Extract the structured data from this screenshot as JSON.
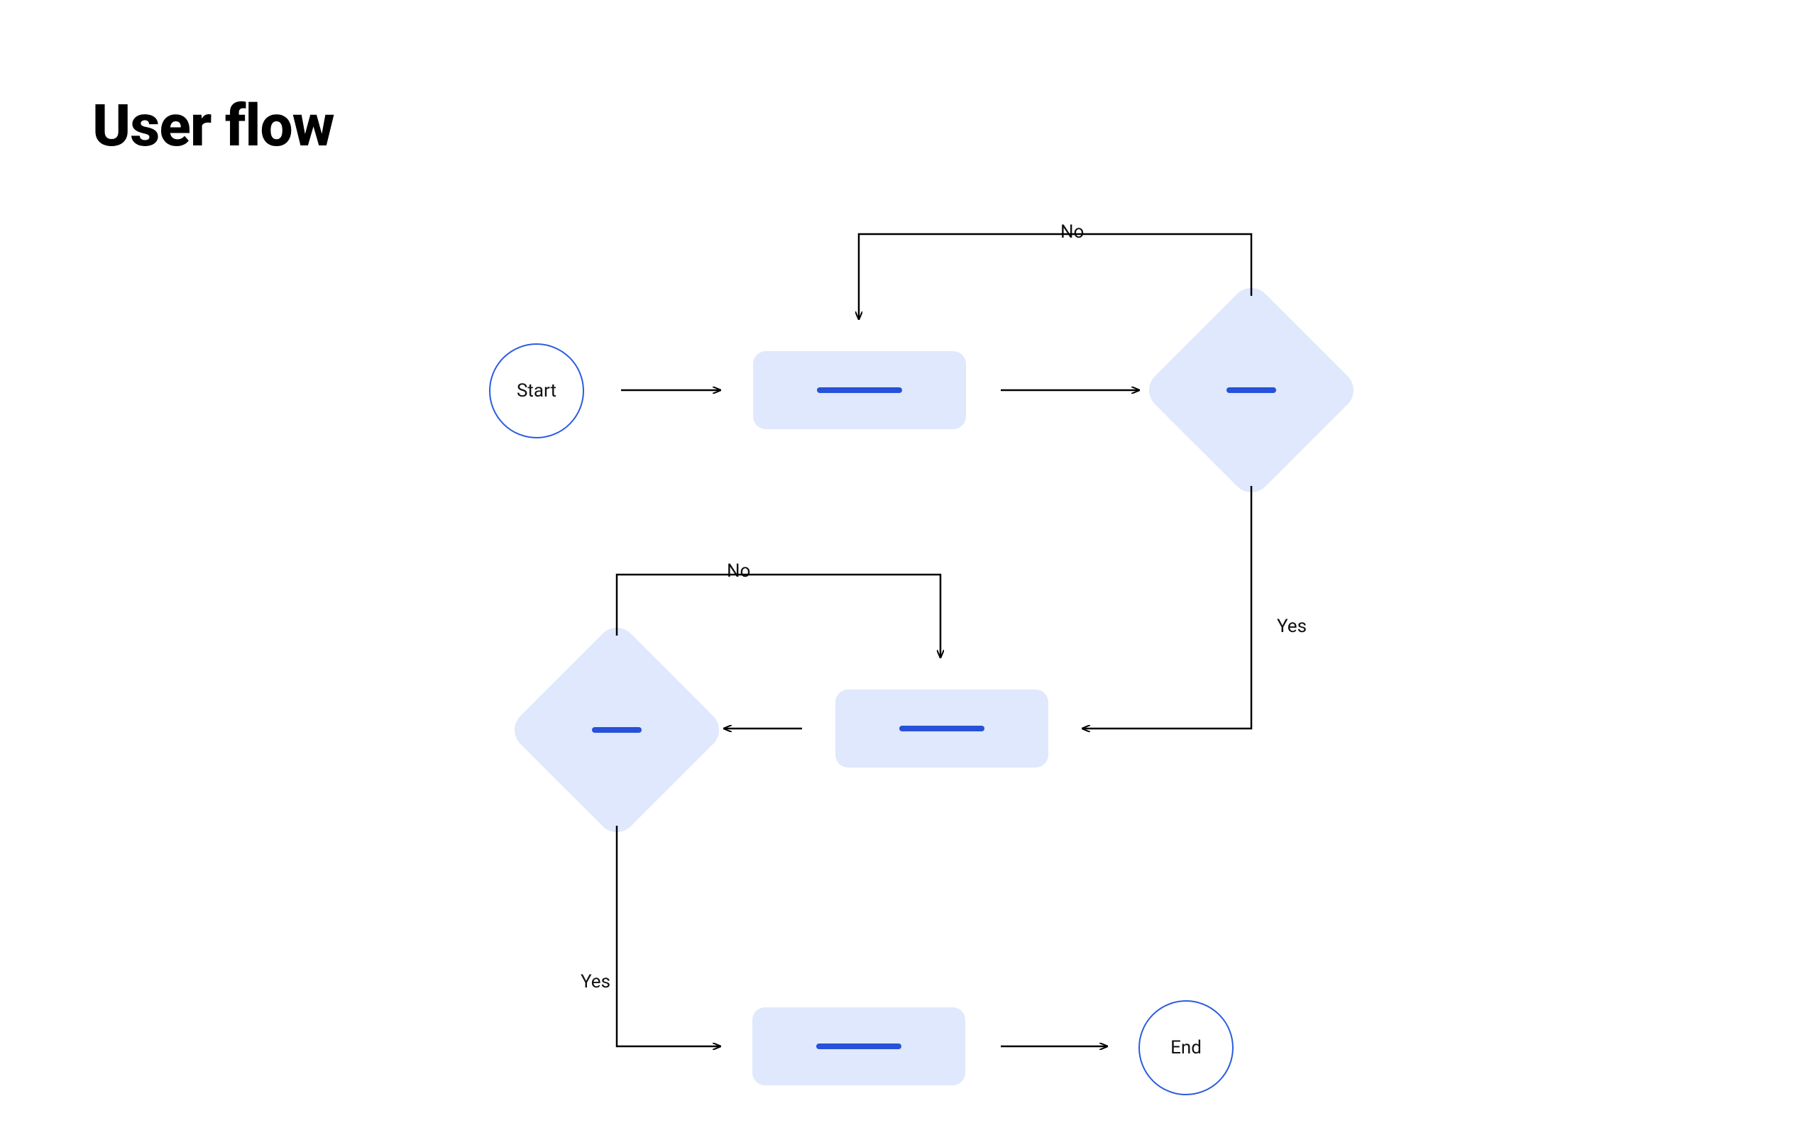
{
  "title": "User flow",
  "nodes": {
    "start": {
      "type": "terminal",
      "label": "Start"
    },
    "process1": {
      "type": "process"
    },
    "decision1": {
      "type": "decision"
    },
    "process2": {
      "type": "process"
    },
    "decision2": {
      "type": "decision"
    },
    "process3": {
      "type": "process"
    },
    "end": {
      "type": "terminal",
      "label": "End"
    }
  },
  "edges": [
    {
      "from": "start",
      "to": "process1"
    },
    {
      "from": "process1",
      "to": "decision1"
    },
    {
      "from": "decision1",
      "to": "process1",
      "label": "No"
    },
    {
      "from": "decision1",
      "to": "process2",
      "label": "Yes"
    },
    {
      "from": "process2",
      "to": "decision2"
    },
    {
      "from": "decision2",
      "to": "process2",
      "label": "No"
    },
    {
      "from": "decision2",
      "to": "process3",
      "label": "Yes"
    },
    {
      "from": "process3",
      "to": "end"
    }
  ],
  "labels": {
    "no1": "No",
    "yes1": "Yes",
    "no2": "No",
    "yes2": "Yes"
  },
  "colors": {
    "nodeFill": "#dfe8fc",
    "accent": "#2751d8",
    "circleBorder": "#2b5ce0",
    "arrow": "#000000"
  }
}
